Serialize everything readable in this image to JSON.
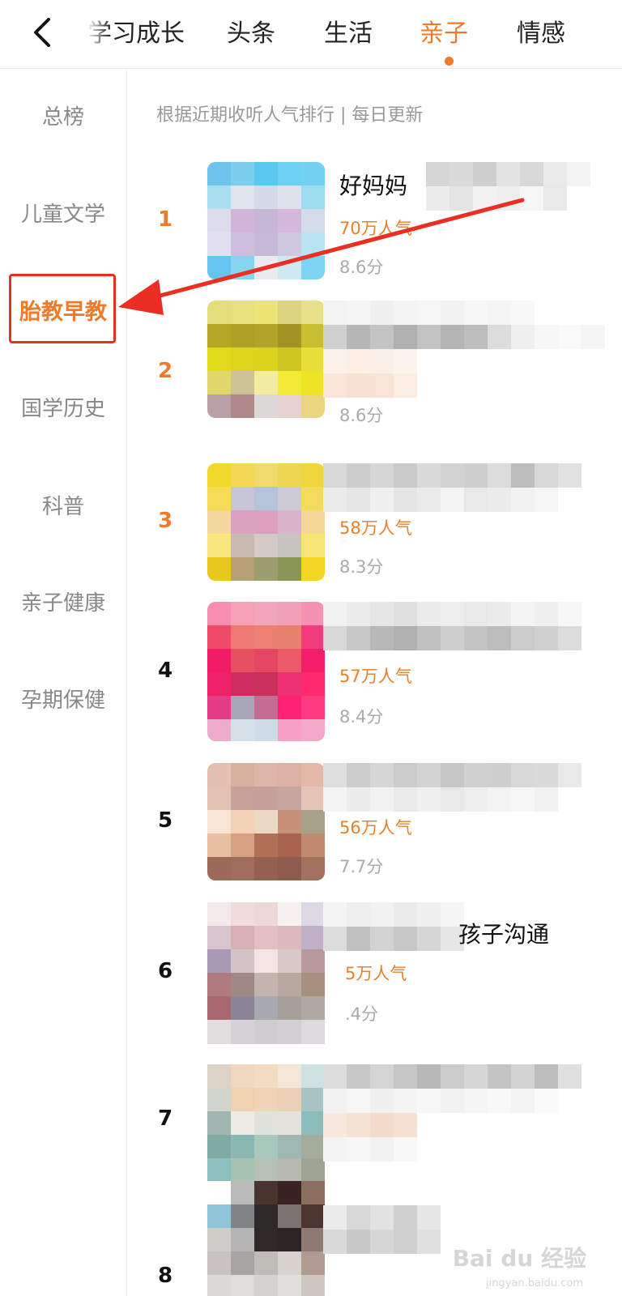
{
  "tabs": [
    {
      "label": "学习成长",
      "active": false
    },
    {
      "label": "头条",
      "active": false
    },
    {
      "label": "生活",
      "active": false
    },
    {
      "label": "亲子",
      "active": true
    },
    {
      "label": "情感",
      "active": false
    }
  ],
  "categories": [
    {
      "label": "总榜",
      "active": false
    },
    {
      "label": "儿童文学",
      "active": false
    },
    {
      "label": "胎教早教",
      "active": true
    },
    {
      "label": "国学历史",
      "active": false
    },
    {
      "label": "科普",
      "active": false
    },
    {
      "label": "亲子健康",
      "active": false
    },
    {
      "label": "孕期保健",
      "active": false
    }
  ],
  "subtitle": "根据近期收听人气排行 | 每日更新",
  "ranking": [
    {
      "rank": "1",
      "title": "好妈妈",
      "popularity": "70万人气",
      "score": "8.6分"
    },
    {
      "rank": "2",
      "title": "",
      "popularity": "",
      "score": "8.6分"
    },
    {
      "rank": "3",
      "title": "",
      "popularity": "58万人气",
      "score": "8.3分"
    },
    {
      "rank": "4",
      "title": "",
      "popularity": "57万人气",
      "score": "8.4分"
    },
    {
      "rank": "5",
      "title": "",
      "popularity": "56万人气",
      "score": "7.7分"
    },
    {
      "rank": "6",
      "title": "孩子沟通",
      "popularity": "5万人气",
      "score": ".4分"
    },
    {
      "rank": "7",
      "title": "",
      "popularity": "",
      "score": ""
    },
    {
      "rank": "8",
      "title": "",
      "popularity": "",
      "score": ""
    }
  ],
  "colors": {
    "accent": "#f07a2a",
    "annotation": "#ea2f22"
  },
  "icons": {
    "back": "chevron-left-icon",
    "annotation": "red-arrow"
  },
  "watermark": {
    "text": "Bai du 经验",
    "sub": "jingyan.baidu.com"
  }
}
